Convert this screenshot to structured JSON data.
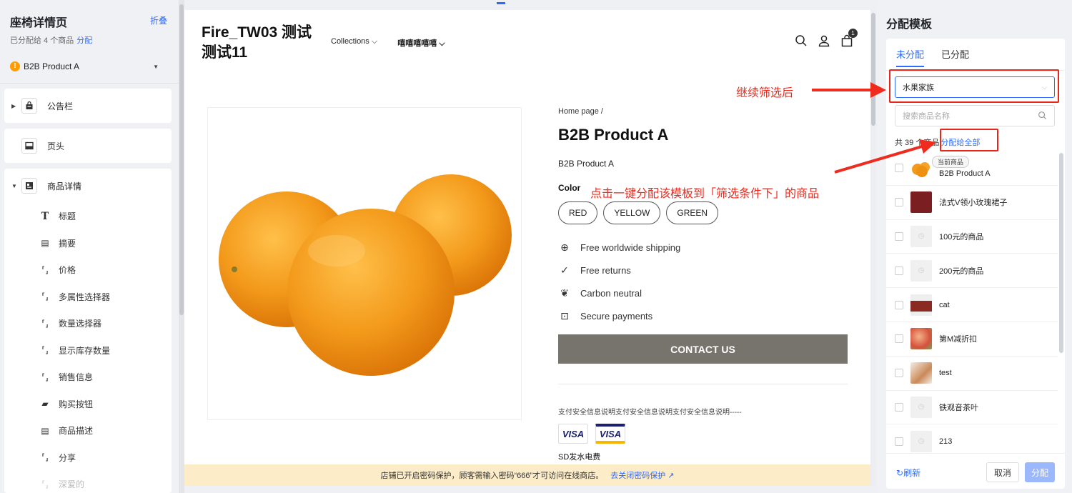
{
  "sidebar": {
    "title": "座椅详情页",
    "fold_label": "折叠",
    "assigned_text": "已分配给 4 个商品",
    "assign_link": "分配",
    "product_select": {
      "value": "B2B Product A",
      "warn_glyph": "!"
    },
    "sections": [
      {
        "label": "公告栏",
        "icon": "bag-icon"
      },
      {
        "label": "页头",
        "icon": "header-icon"
      },
      {
        "label": "商品详情",
        "icon": "detail-icon"
      }
    ],
    "detail_items": [
      {
        "label": "标题",
        "icon": "title-icon",
        "glyph": "T"
      },
      {
        "label": "摘要",
        "icon": "summary-icon",
        "glyph": "▤"
      },
      {
        "label": "价格",
        "icon": "bracket-icon",
        "glyph": "⸢⸥"
      },
      {
        "label": "多属性选择器",
        "icon": "bracket-icon",
        "glyph": "⸢⸥"
      },
      {
        "label": "数量选择器",
        "icon": "bracket-icon",
        "glyph": "⸢⸥"
      },
      {
        "label": "显示库存数量",
        "icon": "bracket-icon",
        "glyph": "⸢⸥"
      },
      {
        "label": "销售信息",
        "icon": "bracket-icon",
        "glyph": "⸢⸥"
      },
      {
        "label": "购买按钮",
        "icon": "buy-icon",
        "glyph": "▰"
      },
      {
        "label": "商品描述",
        "icon": "description-icon",
        "glyph": "▤"
      },
      {
        "label": "分享",
        "icon": "bracket-icon",
        "glyph": "⸢⸥"
      },
      {
        "label": "深爱的",
        "icon": "bracket-icon",
        "glyph": "⸢⸥"
      }
    ]
  },
  "preview": {
    "store_name": "Fire_TW03 测试 测试11",
    "nav": [
      "Collections",
      "嘻嘻嘻嘻嘻"
    ],
    "cart_count": "1",
    "breadcrumb": "Home page /",
    "product_title": "B2B Product A",
    "product_subtitle": "B2B Product A",
    "color_label": "Color",
    "colors": [
      "RED",
      "YELLOW",
      "GREEN"
    ],
    "features": [
      {
        "label": "Free worldwide shipping",
        "icon": "globe-icon",
        "glyph": "⊕"
      },
      {
        "label": "Free returns",
        "icon": "check-circle-icon",
        "glyph": "✓"
      },
      {
        "label": "Carbon neutral",
        "icon": "leaf-icon",
        "glyph": "❦"
      },
      {
        "label": "Secure payments",
        "icon": "lock-box-icon",
        "glyph": "⊡"
      }
    ],
    "contact_label": "CONTACT US",
    "payment_note": "支付安全信息说明支付安全信息说明支付安全信息说明-----",
    "card_label": "VISA",
    "sd_fee": "SD发水电费",
    "password_notice": "店铺已开启密码保护，顾客需输入密码“666”才可访问在线商店。",
    "password_link": "去关闭密码保护 ↗"
  },
  "annotations": {
    "filter_note": "继续筛选后",
    "assign_all_note": "点击一键分配该模板到「筛选条件下」的商品"
  },
  "panel": {
    "title": "分配模板",
    "tabs": [
      "未分配",
      "已分配"
    ],
    "filter_value": "水果家族",
    "search_placeholder": "搜索商品名称",
    "count_text": "共 39 个商品",
    "assign_all": "分配给全部",
    "current_tag": "当前商品",
    "items": [
      {
        "name": "B2B Product A",
        "thumb": "orange"
      },
      {
        "name": "法式V领小玫瑰裙子",
        "thumb": "dress"
      },
      {
        "name": "100元的商品",
        "thumb": "placeholder"
      },
      {
        "name": "200元的商品",
        "thumb": "placeholder"
      },
      {
        "name": "cat",
        "thumb": "person"
      },
      {
        "name": "第M减折扣",
        "thumb": "flowers"
      },
      {
        "name": "test",
        "thumb": "photo"
      },
      {
        "name": "铁观音茶叶",
        "thumb": "placeholder"
      },
      {
        "name": "213",
        "thumb": "placeholder"
      }
    ],
    "refresh_label": "刷新",
    "cancel_label": "取消",
    "assign_label": "分配"
  },
  "colors": {
    "accent": "#2f6bff",
    "annotation_red": "#ee2b1e",
    "contact_bg": "#77736d",
    "notice_bg": "#fdecc8",
    "orange": "#f39a1b"
  }
}
